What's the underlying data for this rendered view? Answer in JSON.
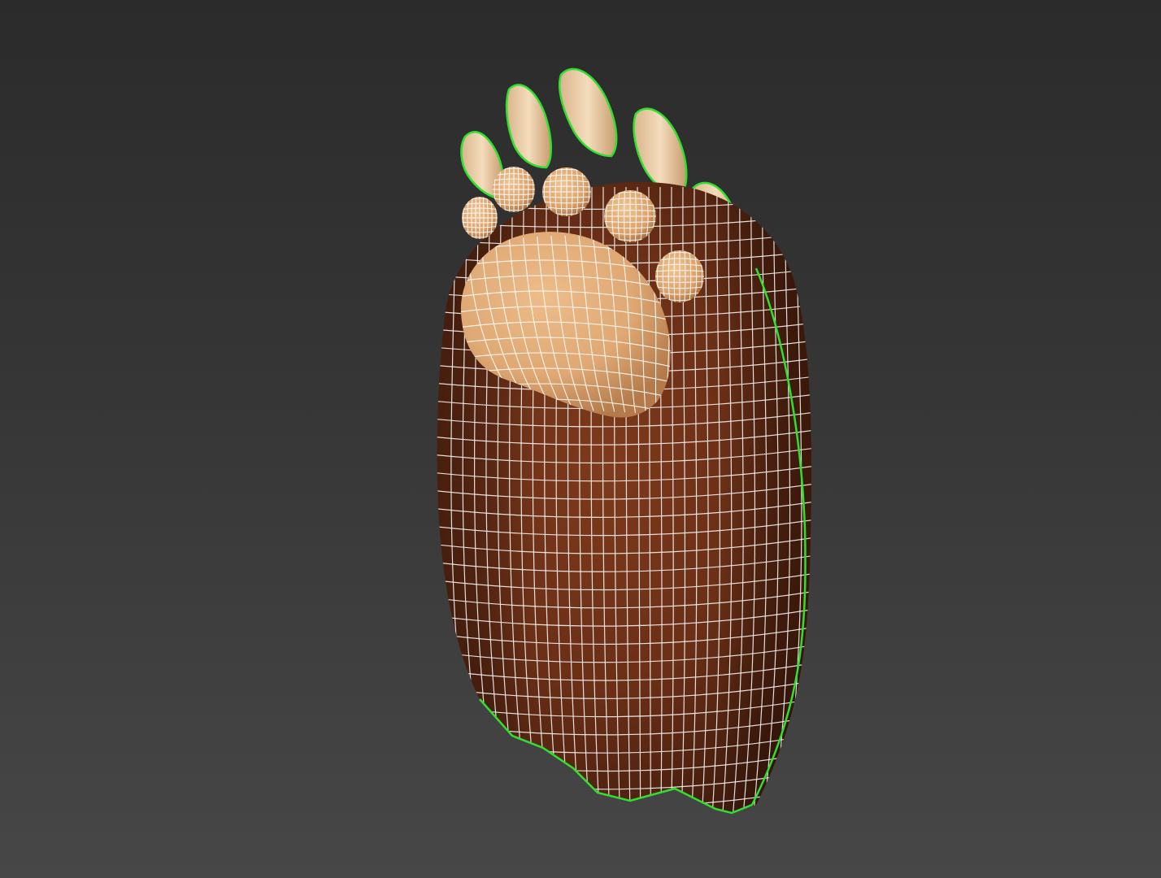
{
  "viewport": {
    "background_top": "#2b2b2b",
    "background_bottom": "#474747"
  },
  "model": {
    "object": "bear-paw-mesh",
    "body_color": "#7a3a1c",
    "pad_color": "#e0aa76",
    "claw_color": "#f0d7b5",
    "wire_color": "#ffffff",
    "selection_outline_color": "#22dd22"
  }
}
